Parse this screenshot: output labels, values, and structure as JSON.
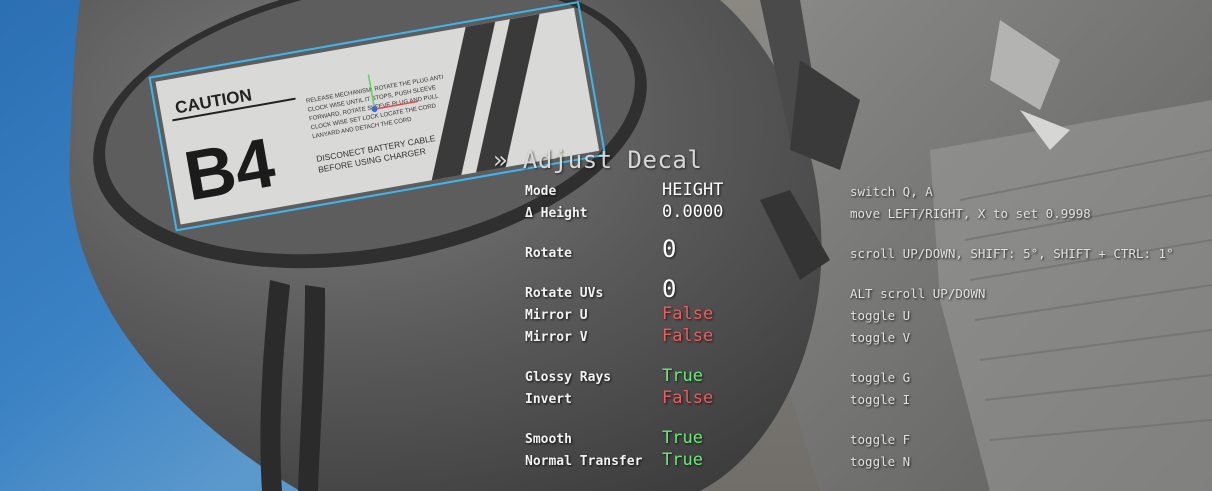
{
  "decal": {
    "caution": "CAUTION",
    "code": "B4",
    "line1": "DISCONECT BATTERY CABLE",
    "line2": "BEFORE USING CHARGER",
    "fine1": "RELEASE MECHANISM: ROTATE THE PLUG ANTI",
    "fine2": "CLOCK WISE UNTIL IT STOPS, PUSH SLEEVE",
    "fine3": "FORWARD, ROTATE SLEEVE PLUG AND PULL",
    "fine4": "CLOCK WISE SET LOCK LOCATE THE CORD",
    "fine5": "LANYARD AND DETACH THE CORD"
  },
  "hud": {
    "title": "» Adjust Decal",
    "rows": [
      {
        "label": "Mode",
        "value": "HEIGHT",
        "hint": "switch Q, A"
      },
      {
        "label": "Δ Height",
        "value": "0.0000",
        "hint": "move LEFT/RIGHT, X to set 0.9998"
      },
      {
        "label": "Rotate",
        "value": "0",
        "hint": "scroll UP/DOWN, SHIFT: 5°, SHIFT + CTRL: 1°"
      },
      {
        "label": "Rotate UVs",
        "value": "0",
        "hint": "ALT scroll UP/DOWN"
      },
      {
        "label": "Mirror U",
        "value": "False",
        "hint": "toggle U"
      },
      {
        "label": "Mirror V",
        "value": "False",
        "hint": "toggle V"
      },
      {
        "label": "Glossy Rays",
        "value": "True",
        "hint": "toggle G"
      },
      {
        "label": "Invert",
        "value": "False",
        "hint": "toggle I"
      },
      {
        "label": "Smooth",
        "value": "True",
        "hint": "toggle F"
      },
      {
        "label": "Normal Transfer",
        "value": "True",
        "hint": "toggle N"
      }
    ]
  },
  "colors": {
    "true": "#6ee87a",
    "false": "#ee5c5c",
    "selection_outline": "#3fb6ea",
    "background_blue": "#2f6fae"
  }
}
